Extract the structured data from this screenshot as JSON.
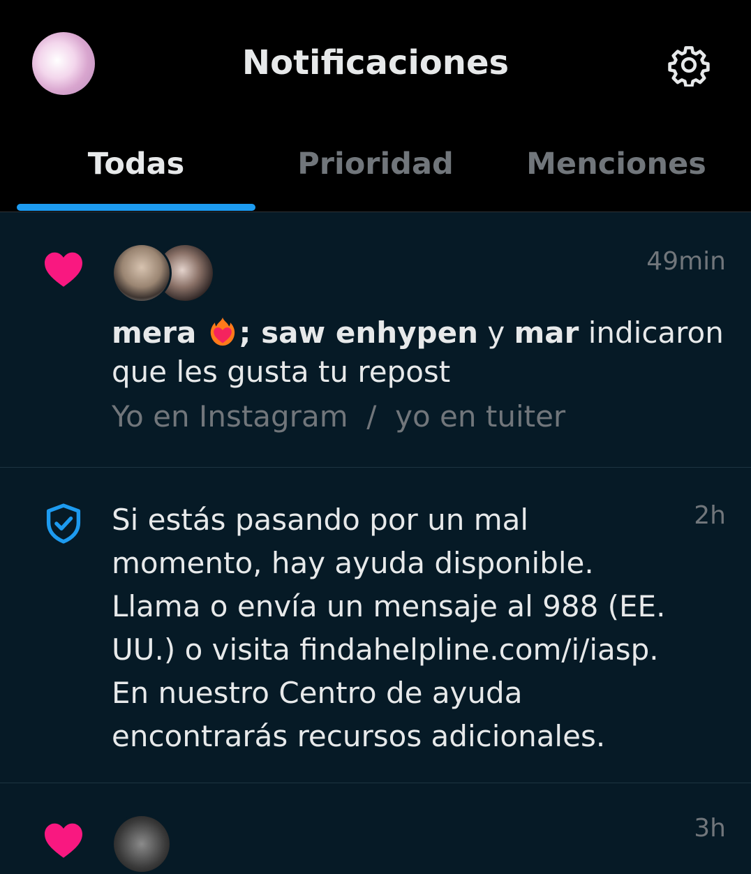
{
  "header": {
    "title": "Notificaciones",
    "avatar_icon": "profile-avatar",
    "settings_icon": "gear-icon"
  },
  "tabs": [
    {
      "label": "Todas",
      "active": true
    },
    {
      "label": "Prioridad",
      "active": false
    },
    {
      "label": "Menciones",
      "active": false
    }
  ],
  "notifications": [
    {
      "type": "like",
      "icon": "heart-icon",
      "time": "49min",
      "user1": "mera",
      "user1_emoji": "heart-on-fire",
      "sep": "; ",
      "user2": "saw enhypen",
      "joiner": " y ",
      "user3": "mar",
      "action": " indicaron que les gusta tu repost",
      "preview": "Yo en Instagram  /  yo en tuiter"
    },
    {
      "type": "safety",
      "icon": "shield-check-icon",
      "time": "2h",
      "text": "Si estás pasando por un mal momento, hay ayuda disponible. Llama o envía un mensaje al 988 (EE. UU.) o visita findahelpline.com/i/iasp. En nuestro Centro de ayuda encontrarás recursos adicionales."
    },
    {
      "type": "like",
      "icon": "heart-icon",
      "time": "3h"
    }
  ],
  "colors": {
    "accent": "#1d9bf0",
    "heart": "#f91880",
    "background": "#061a26",
    "header_bg": "#000000",
    "muted": "#71767b"
  }
}
